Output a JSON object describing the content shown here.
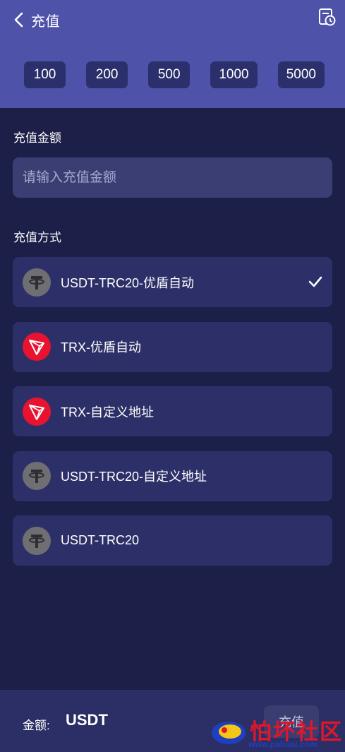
{
  "header": {
    "title": "充值",
    "amount_presets": [
      "100",
      "200",
      "500",
      "1000",
      "5000"
    ]
  },
  "amount_section": {
    "label": "充值金额",
    "placeholder": "请输入充值金额",
    "value": ""
  },
  "method_section": {
    "label": "充值方式",
    "methods": [
      {
        "label": "USDT-TRC20-优盾自动",
        "icon": "tether-icon",
        "selected": true
      },
      {
        "label": "TRX-优盾自动",
        "icon": "tron-icon",
        "selected": false
      },
      {
        "label": "TRX-自定义地址",
        "icon": "tron-icon",
        "selected": false
      },
      {
        "label": "USDT-TRC20-自定义地址",
        "icon": "tether-icon",
        "selected": false
      },
      {
        "label": "USDT-TRC20",
        "icon": "tether-icon",
        "selected": false
      }
    ]
  },
  "footer": {
    "amount_label": "金额:",
    "currency": "USDT",
    "submit_label": "充值"
  },
  "watermark": {
    "text": "怕坏社区",
    "url": "www.pahuai.com"
  },
  "colors": {
    "header_bg": "#4e52a8",
    "page_bg": "#1c1f47",
    "card_bg": "#2d3068",
    "usdt_icon": "#6f6f73",
    "trx_icon": "#e8132f"
  }
}
